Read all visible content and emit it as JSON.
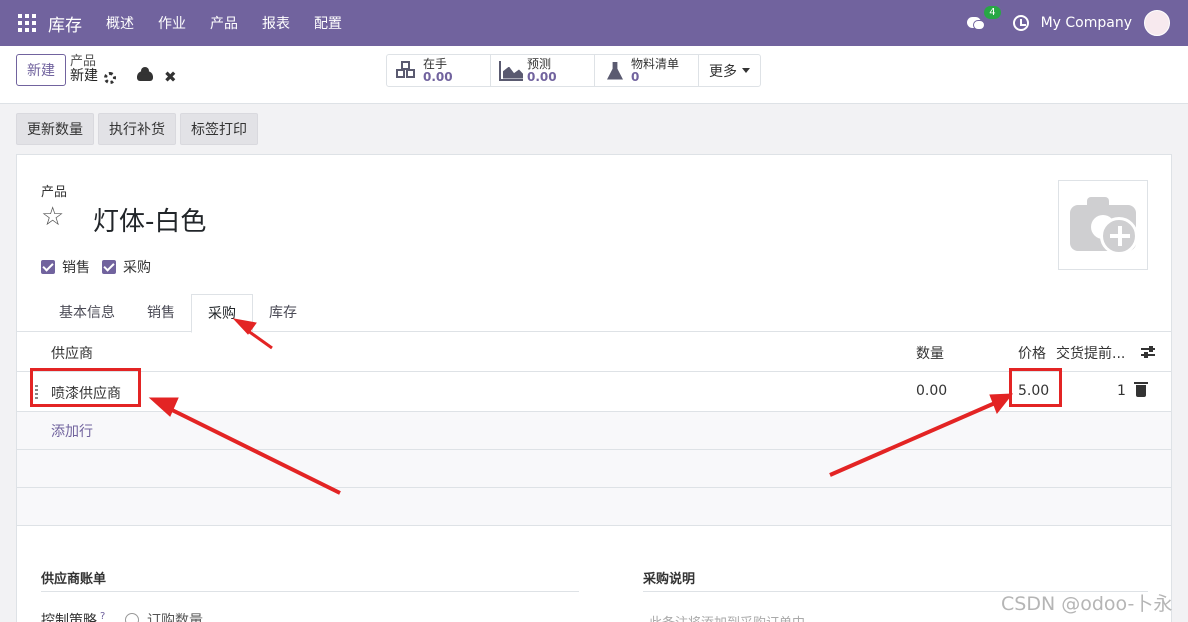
{
  "navbar": {
    "brand": "库存",
    "menu": [
      "概述",
      "作业",
      "产品",
      "报表",
      "配置"
    ],
    "chat_count": "4",
    "company": "My Company"
  },
  "control": {
    "new_label": "新建",
    "breadcrumb_parent": "产品",
    "breadcrumb_current": "新建",
    "stats": [
      {
        "label": "在手",
        "value": "0.00",
        "icon": "cubes-icon"
      },
      {
        "label": "预测",
        "value": "0.00",
        "icon": "area-chart-icon"
      },
      {
        "label": "物料清单",
        "value": "0",
        "icon": "flask-icon"
      }
    ],
    "more_label": "更多"
  },
  "actions": [
    "更新数量",
    "执行补货",
    "标签打印"
  ],
  "form": {
    "product_label": "产品",
    "product_name": "灯体-白色",
    "checkboxes": [
      {
        "label": "销售",
        "checked": true
      },
      {
        "label": "采购",
        "checked": true
      }
    ],
    "tabs": [
      "基本信息",
      "销售",
      "采购",
      "库存"
    ],
    "active_tab": "采购",
    "table": {
      "headers": [
        "供应商",
        "数量",
        "价格",
        "交货提前..."
      ],
      "rows": [
        {
          "vendor": "喷漆供应商",
          "qty": "0.00",
          "price": "5.00",
          "lead": "1"
        }
      ],
      "add_line": "添加行"
    },
    "sections": {
      "vendor_bills": "供应商账单",
      "purchase_desc": "采购说明"
    },
    "control_policy_label": "控制策略",
    "control_policy_help": "?",
    "control_policy_option": "订购数量",
    "purchase_desc_placeholder": "此备注将添加到采购订单中"
  },
  "watermark": "CSDN @odoo-卜永",
  "colors": {
    "brand": "#71639e",
    "highlight": "#e32424"
  }
}
